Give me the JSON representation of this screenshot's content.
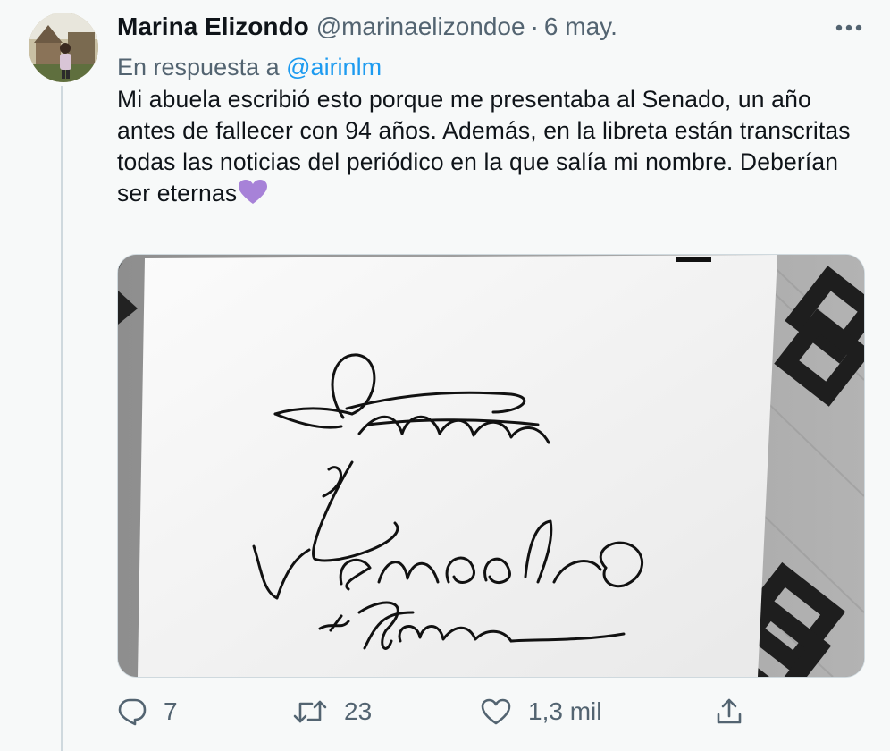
{
  "tweet": {
    "author_name": "Marina Elizondo",
    "author_handle": "@marinaelizondoe",
    "separator": "·",
    "date": "6 may.",
    "replying_to_prefix": "En respuesta a",
    "replying_to_handle": "@airinlm",
    "text": "Mi abuela escribió esto porque me presentaba al Senado, un año antes de fallecer con 94 años. Además, en la libreta están transcritas todas las noticias del periódico en la que salía mi nombre. Deberían ser eternas",
    "emoji": "purple-heart",
    "image_handwriting": "Senado Marina"
  },
  "actions": {
    "replies": "7",
    "retweets": "23",
    "likes": "1,3 mil"
  },
  "colors": {
    "background": "#f7f9f9",
    "text": "#0f1419",
    "secondary": "#536471",
    "link": "#1d9bf0",
    "heart": "#a782d8"
  },
  "icons": {
    "more": "more-icon",
    "reply": "reply-icon",
    "retweet": "retweet-icon",
    "like": "like-icon",
    "share": "share-icon"
  }
}
